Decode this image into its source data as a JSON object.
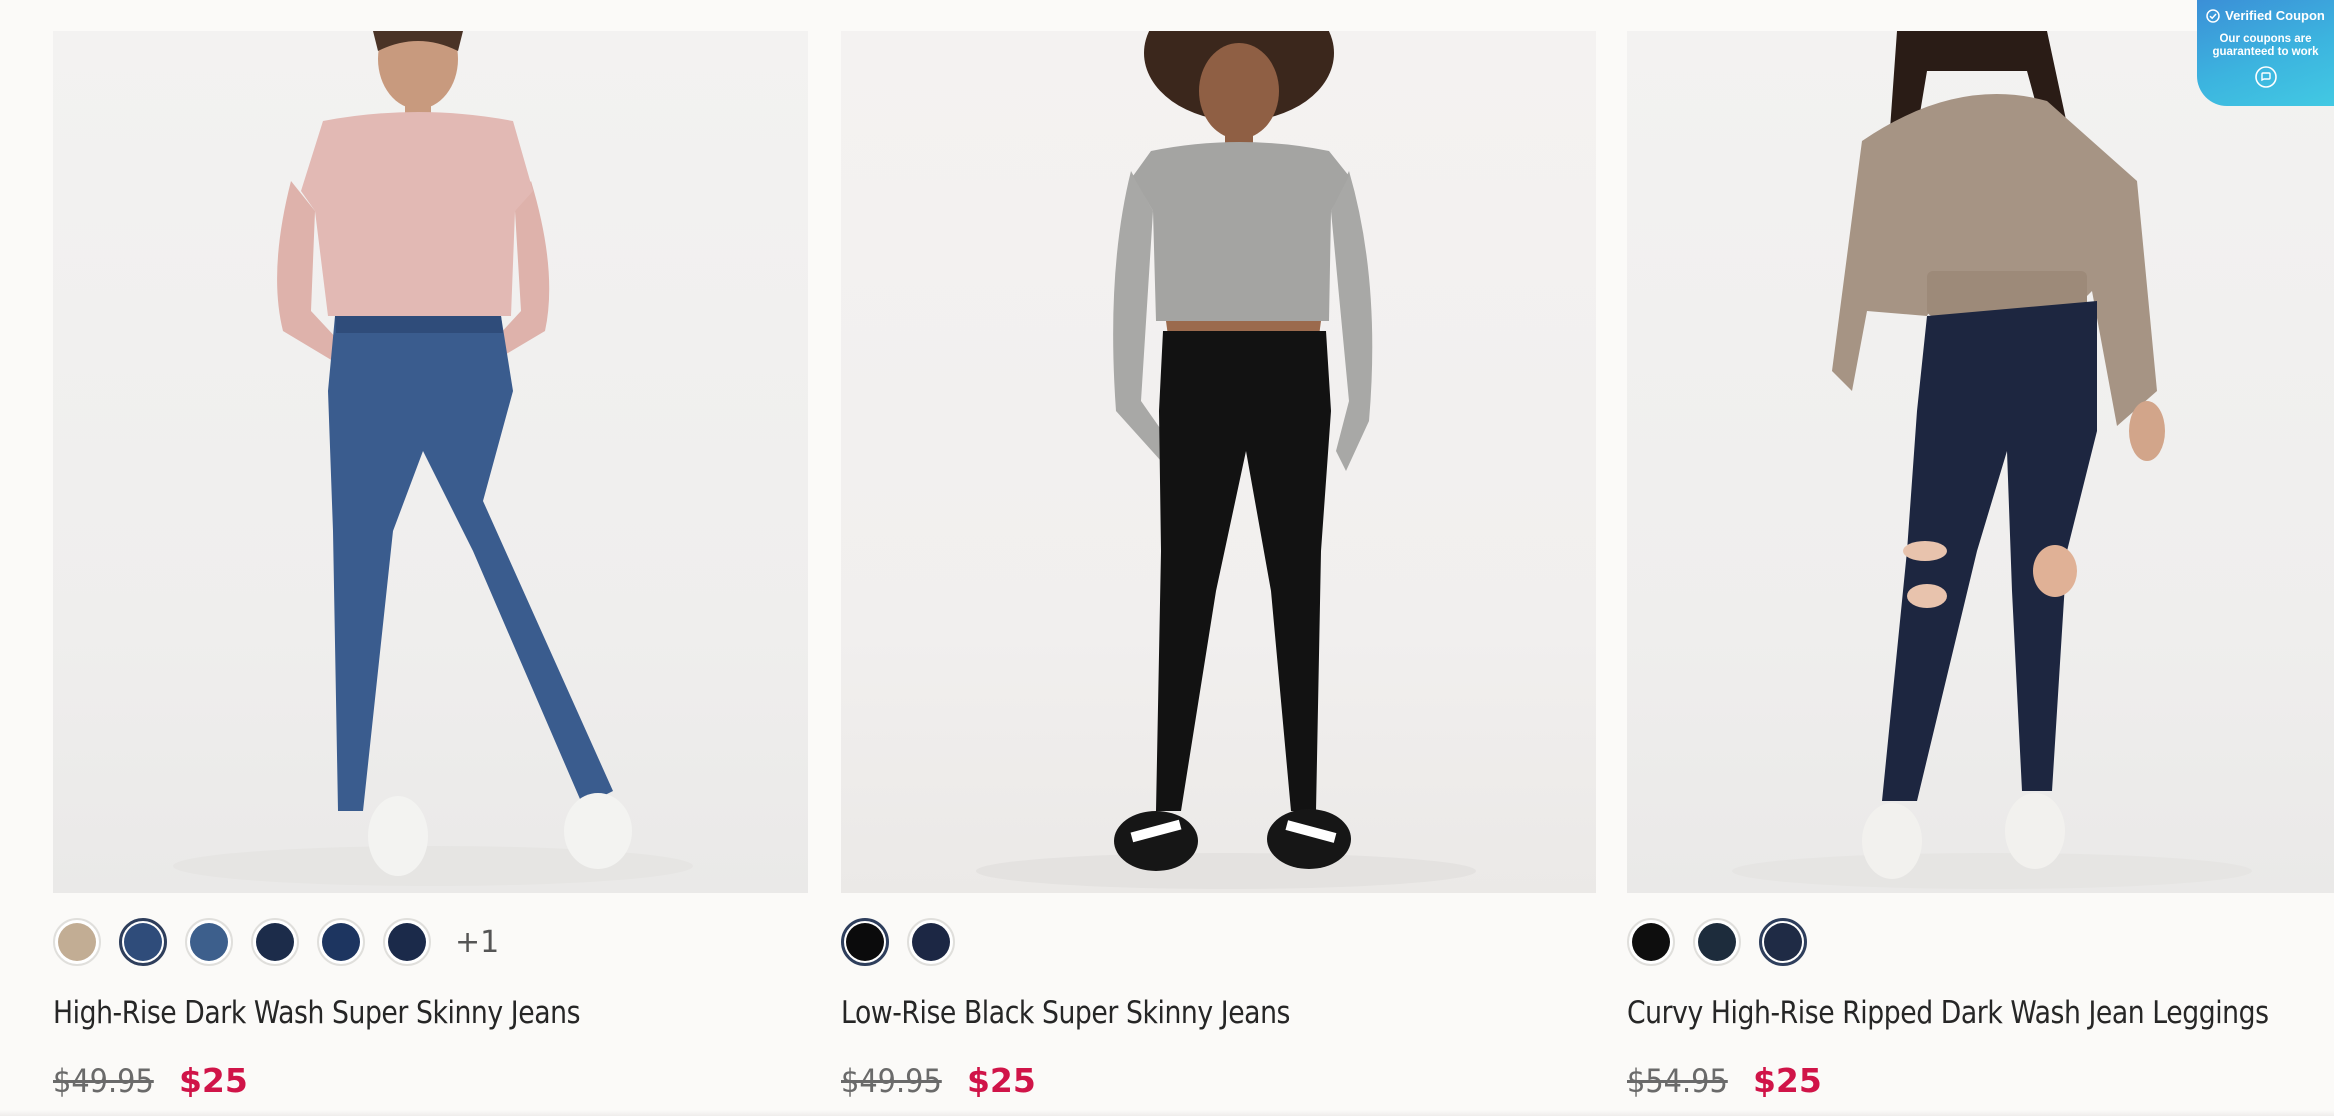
{
  "products": [
    {
      "name": "High-Rise Dark Wash Super Skinny Jeans",
      "old_price": "$49.95",
      "sale_price": "$25",
      "image_alt": "Woman in pink long-sleeve crop top and medium blue skinny jeans",
      "swatches": [
        {
          "color": "#c2ad94",
          "selected": false
        },
        {
          "color": "#2f4c7a",
          "selected": true
        },
        {
          "color": "#3d5f8c",
          "selected": false
        },
        {
          "color": "#1c2c4a",
          "selected": false
        },
        {
          "color": "#1d3560",
          "selected": false
        },
        {
          "color": "#1b2a4a",
          "selected": false
        }
      ],
      "more_swatches": "+1"
    },
    {
      "name": "Low-Rise Black Super Skinny Jeans",
      "old_price": "$49.95",
      "sale_price": "$25",
      "image_alt": "Woman in grey long-sleeve crop top and black skinny jeans",
      "swatches": [
        {
          "color": "#0b0b0c",
          "selected": true
        },
        {
          "color": "#1c2744",
          "selected": false
        }
      ],
      "more_swatches": ""
    },
    {
      "name": "Curvy High-Rise Ripped Dark Wash Jean Leggings",
      "old_price": "$54.95",
      "sale_price": "$25",
      "image_alt": "Woman in taupe half-zip sweatshirt and ripped dark wash jeans",
      "swatches": [
        {
          "color": "#0e0e0e",
          "selected": false
        },
        {
          "color": "#1d2c3c",
          "selected": false
        },
        {
          "color": "#1f2b45",
          "selected": true
        }
      ],
      "more_swatches": ""
    }
  ],
  "coupon_widget": {
    "title": "Verified Coupon",
    "subtitle": "Our coupons are guaranteed to work",
    "check_icon": "check-circle-icon",
    "chat_icon": "chat-bubble-icon"
  },
  "colors": {
    "sale": "#d01448",
    "coupon_gradient_start": "#3b8fd7",
    "coupon_gradient_end": "#42c9e3"
  }
}
